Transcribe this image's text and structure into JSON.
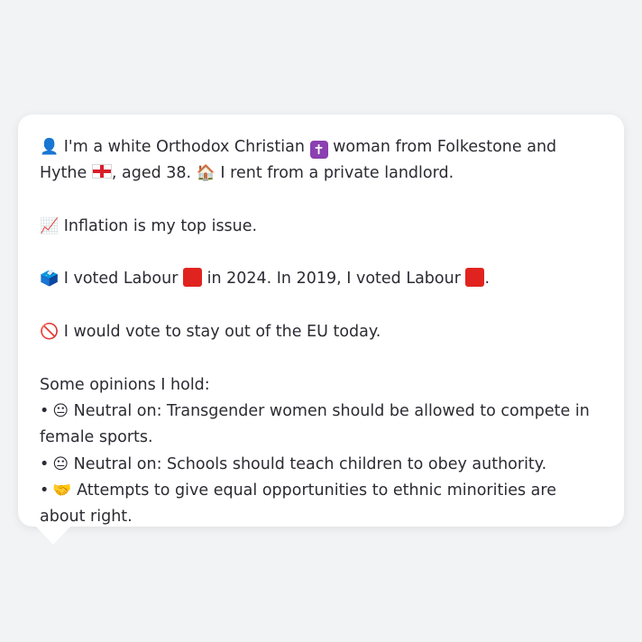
{
  "profile": {
    "line1_a": "I'm a white Orthodox Christian",
    "line1_b": "woman from Folkestone and Hythe",
    "line1_c": ",",
    "line1_d": "aged 38.",
    "line1_e": "I rent from a private landlord.",
    "issue": "Inflation is my top issue.",
    "vote_a": "I voted Labour",
    "vote_b": "in 2024. In 2019, I voted Labour",
    "vote_c": ".",
    "eu": "I would vote to stay out of the EU today.",
    "opinions_heading": "Some opinions I hold:",
    "opinions": [
      {
        "bullet": "•",
        "icon": "😐",
        "text": "Neutral on: Transgender women should be allowed to compete in female sports."
      },
      {
        "bullet": "•",
        "icon": "😐",
        "text": "Neutral on: Schools should teach children to obey authority."
      },
      {
        "bullet": "•",
        "icon": "🤝",
        "text": "Attempts to give equal opportunities to ethnic minorities are about right."
      }
    ]
  },
  "icons": {
    "person": "👤",
    "cross": "✝",
    "house": "🏠",
    "chart": "📈",
    "ballot": "🗳️",
    "no_entry": "🚫"
  },
  "colors": {
    "labour_red": "#e1231f",
    "cross_badge": "#8b3fb0"
  }
}
